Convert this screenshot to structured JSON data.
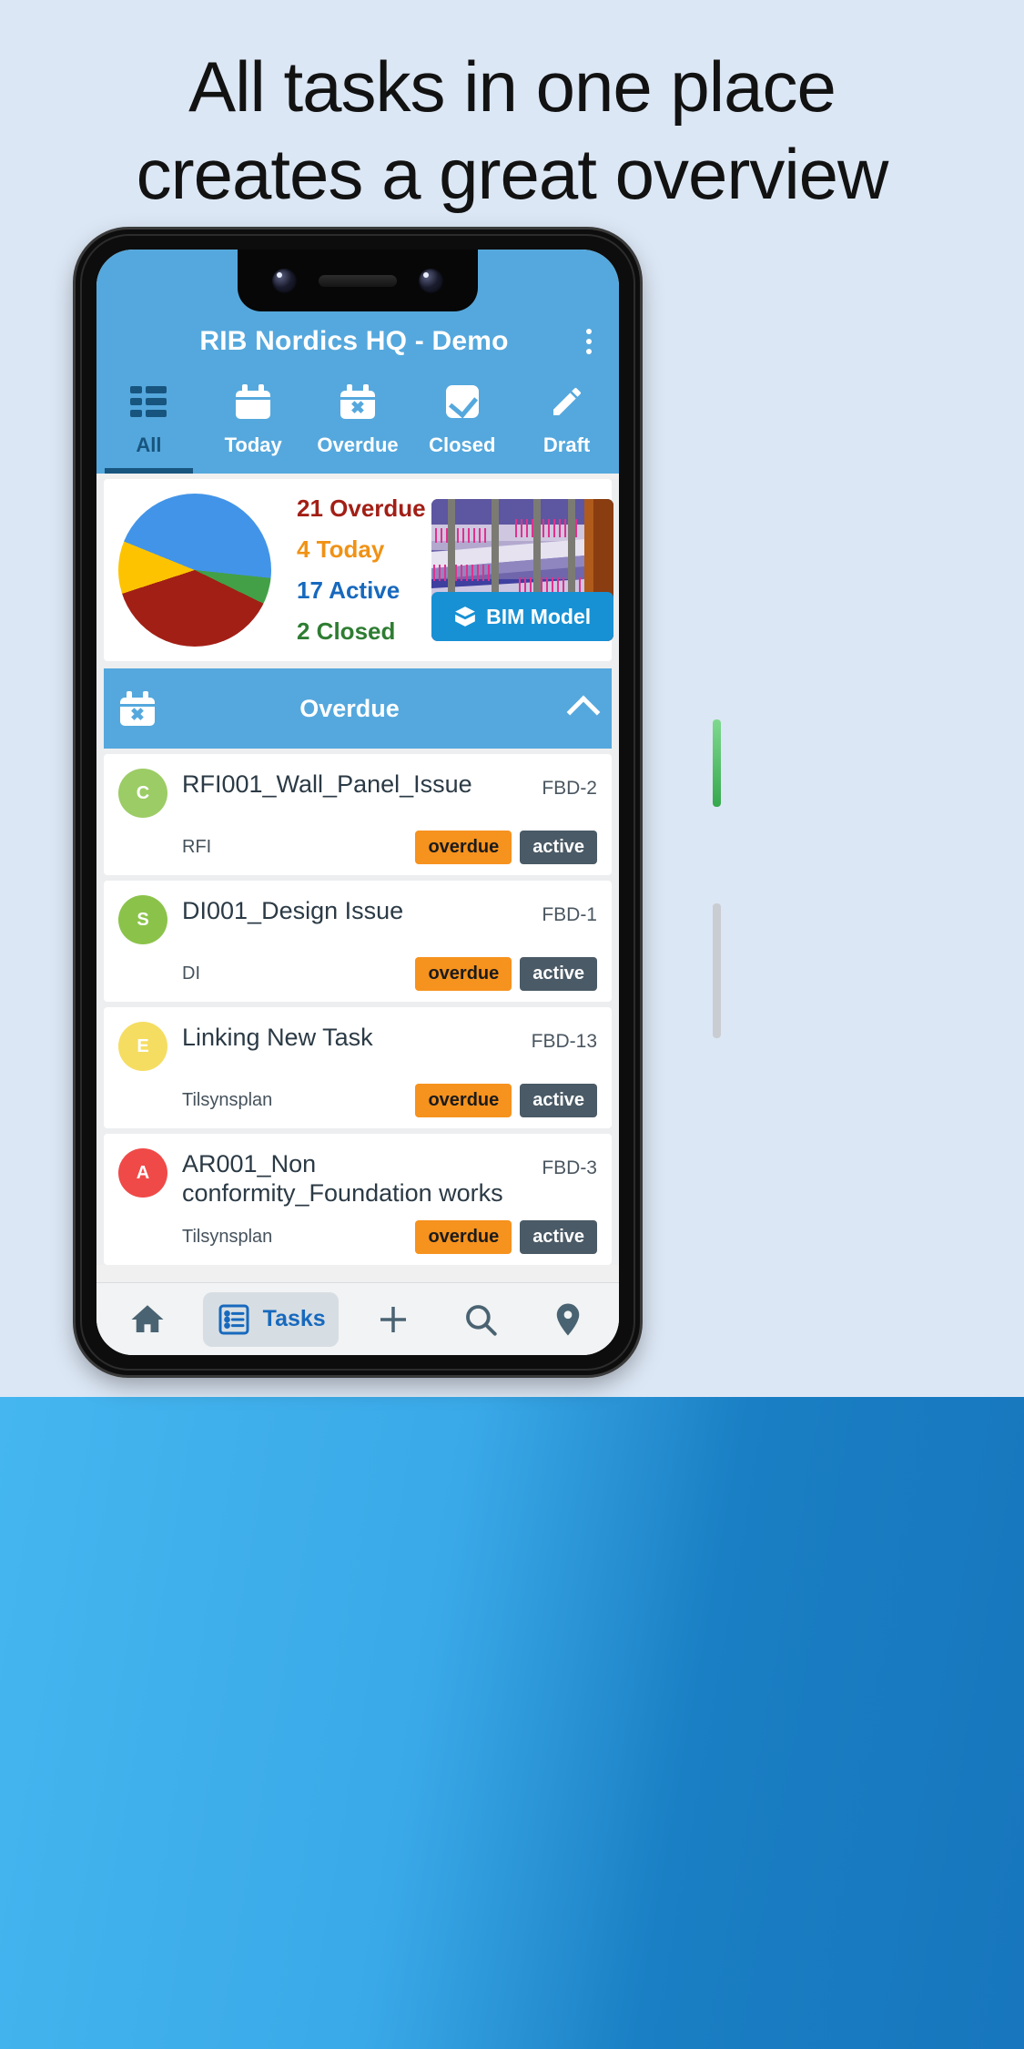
{
  "headline": {
    "line1": "All tasks in one place",
    "line2": "creates a great overview"
  },
  "colors": {
    "brand_blue": "#55a8dd",
    "accent_blue": "#1791d4",
    "overdue_red": "#a21f16",
    "today_orange": "#f09215",
    "active_blue": "#1769bd",
    "closed_green": "#2e7d32",
    "badge_overdue": "#f6921e",
    "badge_active": "#4a5a66"
  },
  "app": {
    "title": "RIB Nordics HQ -  Demo",
    "menu_icon": "kebab-menu-icon",
    "tabs": [
      {
        "label": "All",
        "icon": "list-icon",
        "active": true
      },
      {
        "label": "Today",
        "icon": "calendar-icon",
        "active": false
      },
      {
        "label": "Overdue",
        "icon": "calendar-x-icon",
        "active": false
      },
      {
        "label": "Closed",
        "icon": "checkbox-icon",
        "active": false
      },
      {
        "label": "Draft",
        "icon": "pencil-icon",
        "active": false
      }
    ]
  },
  "stats": {
    "legend": [
      {
        "count": "21",
        "label": "Overdue"
      },
      {
        "count": "4",
        "label": "Today"
      },
      {
        "count": "17",
        "label": "Active"
      },
      {
        "count": "2",
        "label": "Closed"
      }
    ],
    "lines": {
      "overdue": "21 Overdue",
      "today": "4 Today",
      "active": "17 Active",
      "closed": "2 Closed"
    },
    "bim_button_label": "BIM Model",
    "bim_button_icon": "cube-icon"
  },
  "chart_data": {
    "type": "pie",
    "title": "Task status distribution",
    "categories": [
      "Overdue",
      "Today",
      "Active",
      "Closed"
    ],
    "values": [
      21,
      4,
      17,
      2
    ],
    "colors": [
      "#a21f16",
      "#fdc300",
      "#4294e8",
      "#43a047"
    ],
    "legend_position": "right",
    "grid": false
  },
  "section": {
    "title": "Overdue",
    "icon": "calendar-x-icon",
    "collapse_icon": "chevron-up-icon"
  },
  "tasks": [
    {
      "avatar_letter": "C",
      "avatar_color": "#9ccc65",
      "name": "RFI001_Wall_Panel_Issue",
      "ref": "FBD-2",
      "type": "RFI",
      "badges": [
        "overdue",
        "active"
      ]
    },
    {
      "avatar_letter": "S",
      "avatar_color": "#8bc34a",
      "name": "DI001_Design Issue",
      "ref": "FBD-1",
      "type": "DI",
      "badges": [
        "overdue",
        "active"
      ]
    },
    {
      "avatar_letter": "E",
      "avatar_color": "#f5dd62",
      "name": "Linking New Task",
      "ref": "FBD-13",
      "type": "Tilsynsplan",
      "badges": [
        "overdue",
        "active"
      ]
    },
    {
      "avatar_letter": "A",
      "avatar_color": "#ef4a48",
      "name": "AR001_Non conformity_Foundation works",
      "ref": "FBD-3",
      "type": "Tilsynsplan",
      "badges": [
        "overdue",
        "active"
      ]
    }
  ],
  "bottom_nav": [
    {
      "label": "",
      "icon": "home-icon",
      "active": false
    },
    {
      "label": "Tasks",
      "icon": "tasks-icon",
      "active": true
    },
    {
      "label": "",
      "icon": "plus-icon",
      "active": false
    },
    {
      "label": "",
      "icon": "search-icon",
      "active": false
    },
    {
      "label": "",
      "icon": "location-pin-icon",
      "active": false
    }
  ]
}
